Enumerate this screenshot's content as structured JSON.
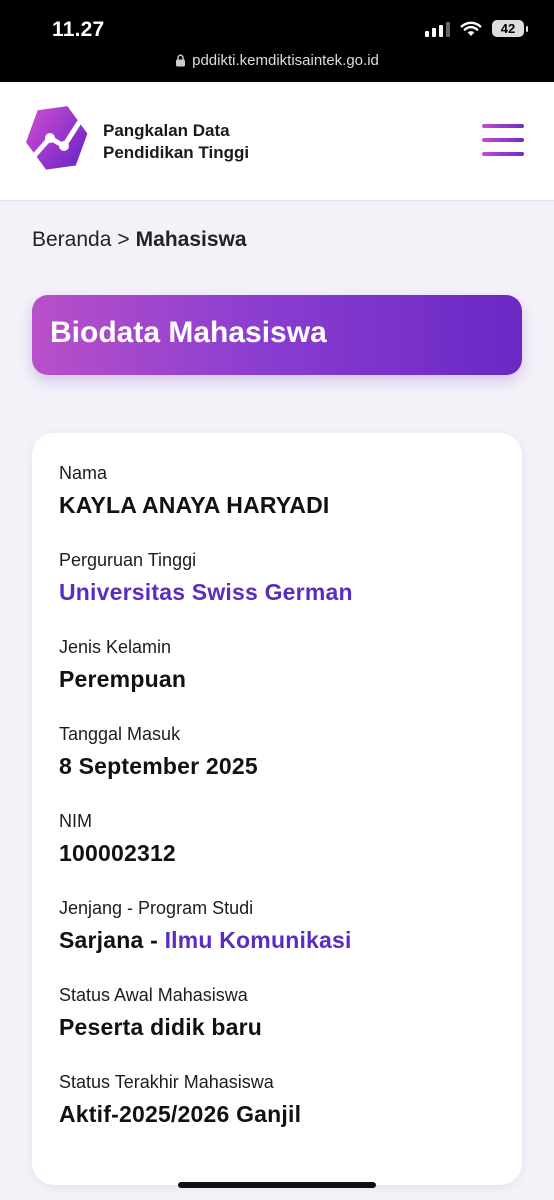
{
  "status_bar": {
    "time": "11.27",
    "battery": "42",
    "url": "pddikti.kemdiktisaintek.go.id"
  },
  "header": {
    "brand_line1": "Pangkalan Data",
    "brand_line2": "Pendidikan Tinggi",
    "accent_gradient": [
      "#c54bcc",
      "#6b2bc9"
    ],
    "menu_icon": "hamburger-menu-icon"
  },
  "breadcrumb": {
    "home": "Beranda",
    "separator": ">",
    "current": "Mahasiswa"
  },
  "page": {
    "title": "Biodata Mahasiswa"
  },
  "student": {
    "nama_label": "Nama",
    "nama": "KAYLA ANAYA HARYADI",
    "pt_label": "Perguruan Tinggi",
    "pt": "Universitas Swiss German",
    "jk_label": "Jenis Kelamin",
    "jk": "Perempuan",
    "masuk_label": "Tanggal Masuk",
    "masuk": "8 September 2025",
    "nim_label": "NIM",
    "nim": "100002312",
    "prodi_label": "Jenjang - Program Studi",
    "jenjang": "Sarjana",
    "prodi_sep": " - ",
    "prodi": "Ilmu Komunikasi",
    "status_awal_label": "Status Awal Mahasiswa",
    "status_awal": "Peserta didik baru",
    "status_akhir_label": "Status Terakhir Mahasiswa",
    "status_akhir": "Aktif-2025/2026 Ganjil"
  }
}
